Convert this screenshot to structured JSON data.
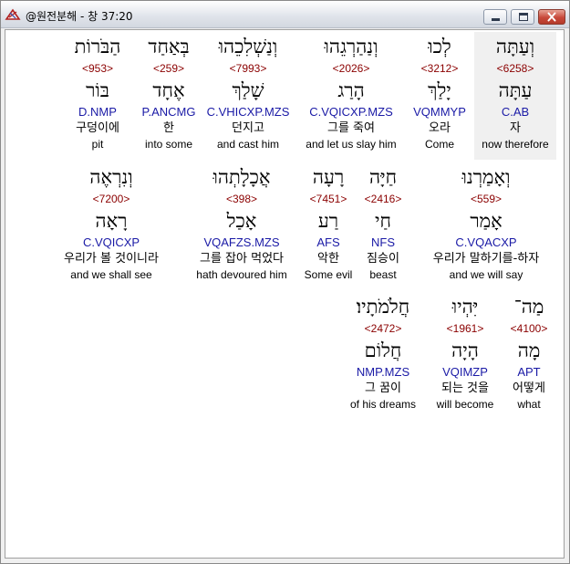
{
  "window": {
    "title": "@원전분해 - 창 37:20"
  },
  "rows": [
    [
      {
        "heb": "וְעַתָּה",
        "num": "<6258>",
        "lemma": "עַתָּה",
        "code": "C.AB",
        "kor": "자",
        "eng": "now therefore",
        "highlight": true
      },
      {
        "heb": "לְכוּ",
        "num": "<3212>",
        "lemma": "יָלַךְ",
        "code": "VQMMYP",
        "kor": "오라",
        "eng": "Come"
      },
      {
        "heb": "וְנַהַרְגֵהוּ",
        "num": "<2026>",
        "lemma": "הָרַג",
        "code": "C.VQICXP.MZS",
        "kor": "그를 죽여",
        "eng": "and let us slay him"
      },
      {
        "heb": "וְנַשְׁלִכֵהוּ",
        "num": "<7993>",
        "lemma": "שָׁלַךְ",
        "code": "C.VHICXP.MZS",
        "kor": "던지고",
        "eng": "and cast him"
      },
      {
        "heb": "בְּאַחַד",
        "num": "<259>",
        "lemma": "אֶחָד",
        "code": "P.ANCMG",
        "kor": "한",
        "eng": "into some"
      },
      {
        "heb": "הַבֹּרוֹת",
        "num": "<953>",
        "lemma": "בּוֹר",
        "code": "D.NMP",
        "kor": "구덩이에",
        "eng": "pit"
      }
    ],
    [
      {
        "heb": "וְאָמַרְנוּ",
        "num": "<559>",
        "lemma": "אָמַר",
        "code": "C.VQACXP",
        "kor": "우리가 말하기를-하자",
        "eng": "and we will say"
      },
      {
        "heb": "חַיָּה",
        "num": "<2416>",
        "lemma": "חַי",
        "code": "NFS",
        "kor": "짐승이",
        "eng": "beast"
      },
      {
        "heb": "רָעָה",
        "num": "<7451>",
        "lemma": "רַע",
        "code": "AFS",
        "kor": "악한",
        "eng": "Some evil"
      },
      {
        "heb": "אֲכָלָתְהוּ",
        "num": "<398>",
        "lemma": "אָכַל",
        "code": "VQAFZS.MZS",
        "kor": "그를 잡아 먹었다",
        "eng": "hath devoured him"
      },
      {
        "heb": "וְנִרְאֶה",
        "num": "<7200>",
        "lemma": "רָאָה",
        "code": "C.VQICXP",
        "kor": "우리가 볼 것이니라",
        "eng": "and we shall see"
      }
    ],
    [
      {
        "heb": "מַה־",
        "num": "<4100>",
        "lemma": "מָה",
        "code": "APT",
        "kor": "어떻게",
        "eng": "what"
      },
      {
        "heb": "יִּהְיוּ",
        "num": "<1961>",
        "lemma": "הָיָה",
        "code": "VQIMZP",
        "kor": "되는 것을",
        "eng": "will become"
      },
      {
        "heb": "חֲלֹמֹתָיו׃",
        "num": "<2472>",
        "lemma": "חֲלוֹם",
        "code": "NMP.MZS",
        "kor": "그 꿈이",
        "eng": "of his dreams"
      }
    ]
  ]
}
